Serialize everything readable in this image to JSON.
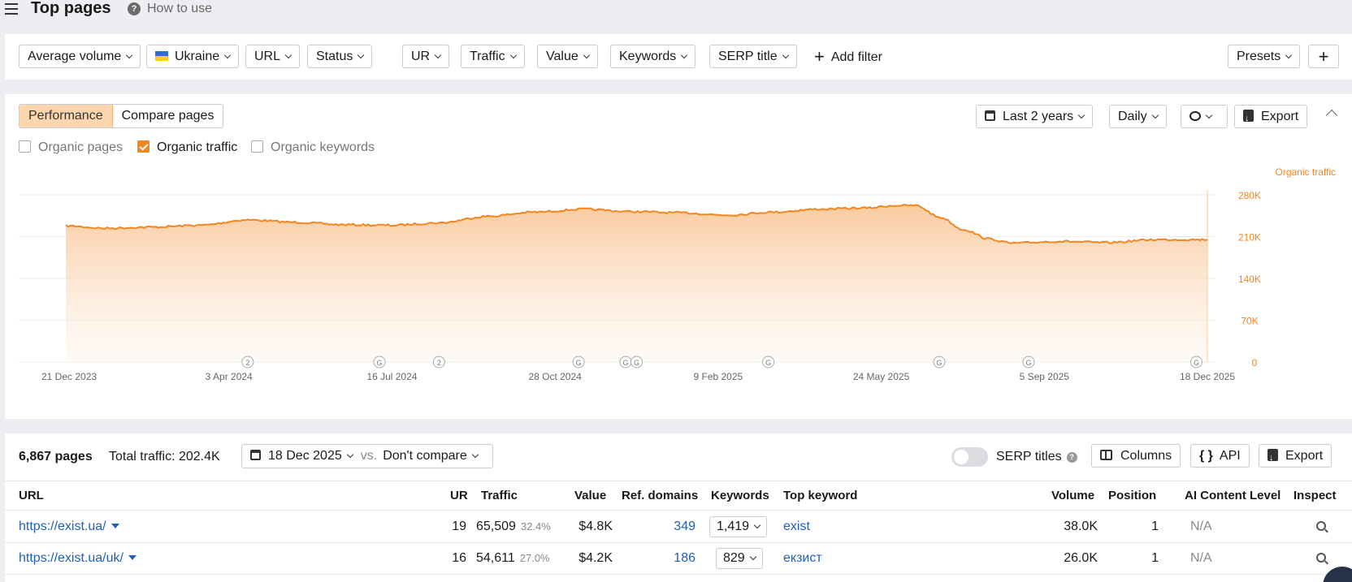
{
  "header": {
    "title": "Top pages",
    "how_to_use": "How to use"
  },
  "filters": {
    "items": [
      "Average volume",
      "Ukraine",
      "URL",
      "Status",
      "UR",
      "Traffic",
      "Value",
      "Keywords",
      "SERP title"
    ],
    "add_filter": "Add filter",
    "presets": "Presets"
  },
  "performance": {
    "tabs": [
      "Performance",
      "Compare pages"
    ],
    "active_tab": "Performance",
    "checkboxes": [
      {
        "label": "Organic pages",
        "checked": false
      },
      {
        "label": "Organic traffic",
        "checked": true
      },
      {
        "label": "Organic keywords",
        "checked": false
      }
    ],
    "period": "Last 2 years",
    "granularity": "Daily",
    "export": "Export"
  },
  "chart_data": {
    "type": "area",
    "series": [
      {
        "name": "Organic traffic",
        "color": "#f5851f"
      }
    ],
    "y_axis_label": "Organic traffic",
    "y_ticks": [
      "280K",
      "210K",
      "140K",
      "70K",
      "0"
    ],
    "ylim": [
      0,
      280000
    ],
    "x_ticks": [
      "21 Dec 2023",
      "3 Apr 2024",
      "16 Jul 2024",
      "28 Oct 2024",
      "9 Feb 2025",
      "24 May 2025",
      "5 Sep 2025",
      "18 Dec 2025"
    ],
    "x": [
      "2023-12-21",
      "2024-01-15",
      "2024-02-15",
      "2024-03-15",
      "2024-04-15",
      "2024-05-15",
      "2024-06-15",
      "2024-07-15",
      "2024-08-15",
      "2024-09-15",
      "2024-10-15",
      "2024-11-15",
      "2024-12-15",
      "2025-01-15",
      "2025-02-15",
      "2025-03-15",
      "2025-04-15",
      "2025-05-15",
      "2025-06-01",
      "2025-06-15",
      "2025-07-01",
      "2025-07-15",
      "2025-08-01",
      "2025-08-15",
      "2025-09-15",
      "2025-10-15",
      "2025-11-15",
      "2025-12-18"
    ],
    "values": [
      228000,
      224000,
      226000,
      229000,
      238000,
      234000,
      230000,
      229000,
      233000,
      244000,
      251000,
      256000,
      252000,
      250000,
      246000,
      251000,
      256000,
      258000,
      262000,
      262000,
      242000,
      222000,
      206000,
      199000,
      202000,
      200000,
      205000,
      205000
    ],
    "annotations": [
      {
        "x": "2024-04-15",
        "label": "2"
      },
      {
        "x": "2024-07-08",
        "label": "G"
      },
      {
        "x": "2024-08-15",
        "label": "2"
      },
      {
        "x": "2024-11-12",
        "label": "G"
      },
      {
        "x": "2024-12-12",
        "label": "G"
      },
      {
        "x": "2024-12-19",
        "label": "G"
      },
      {
        "x": "2025-03-13",
        "label": "G"
      },
      {
        "x": "2025-06-30",
        "label": "G"
      },
      {
        "x": "2025-08-26",
        "label": "G"
      },
      {
        "x": "2025-12-11",
        "label": "G"
      }
    ]
  },
  "table": {
    "pages_count": "6,867 pages",
    "total_traffic": "Total traffic: 202.4K",
    "date": "18 Dec 2025",
    "vs": "vs.",
    "compare": "Don't compare",
    "serp_titles": "SERP titles",
    "columns_btn": "Columns",
    "api_btn": "API",
    "export_btn": "Export",
    "headers": {
      "url": "URL",
      "ur": "UR",
      "traffic": "Traffic",
      "value": "Value",
      "ref_domains": "Ref. domains",
      "keywords": "Keywords",
      "top_keyword": "Top keyword",
      "volume": "Volume",
      "position": "Position",
      "ai_content": "AI Content Level",
      "inspect": "Inspect"
    },
    "rows": [
      {
        "url": "https://exist.ua/",
        "ur": "19",
        "traffic": "65,509",
        "pct": "32.4%",
        "value": "$4.8K",
        "ref_domains": "349",
        "keywords": "1,419",
        "top_keyword": "exist",
        "volume": "38.0K",
        "position": "1",
        "ai": "N/A"
      },
      {
        "url": "https://exist.ua/uk/",
        "ur": "16",
        "traffic": "54,611",
        "pct": "27.0%",
        "value": "$4.2K",
        "ref_domains": "186",
        "keywords": "829",
        "top_keyword": "екзист",
        "volume": "26.0K",
        "position": "1",
        "ai": "N/A"
      }
    ]
  }
}
